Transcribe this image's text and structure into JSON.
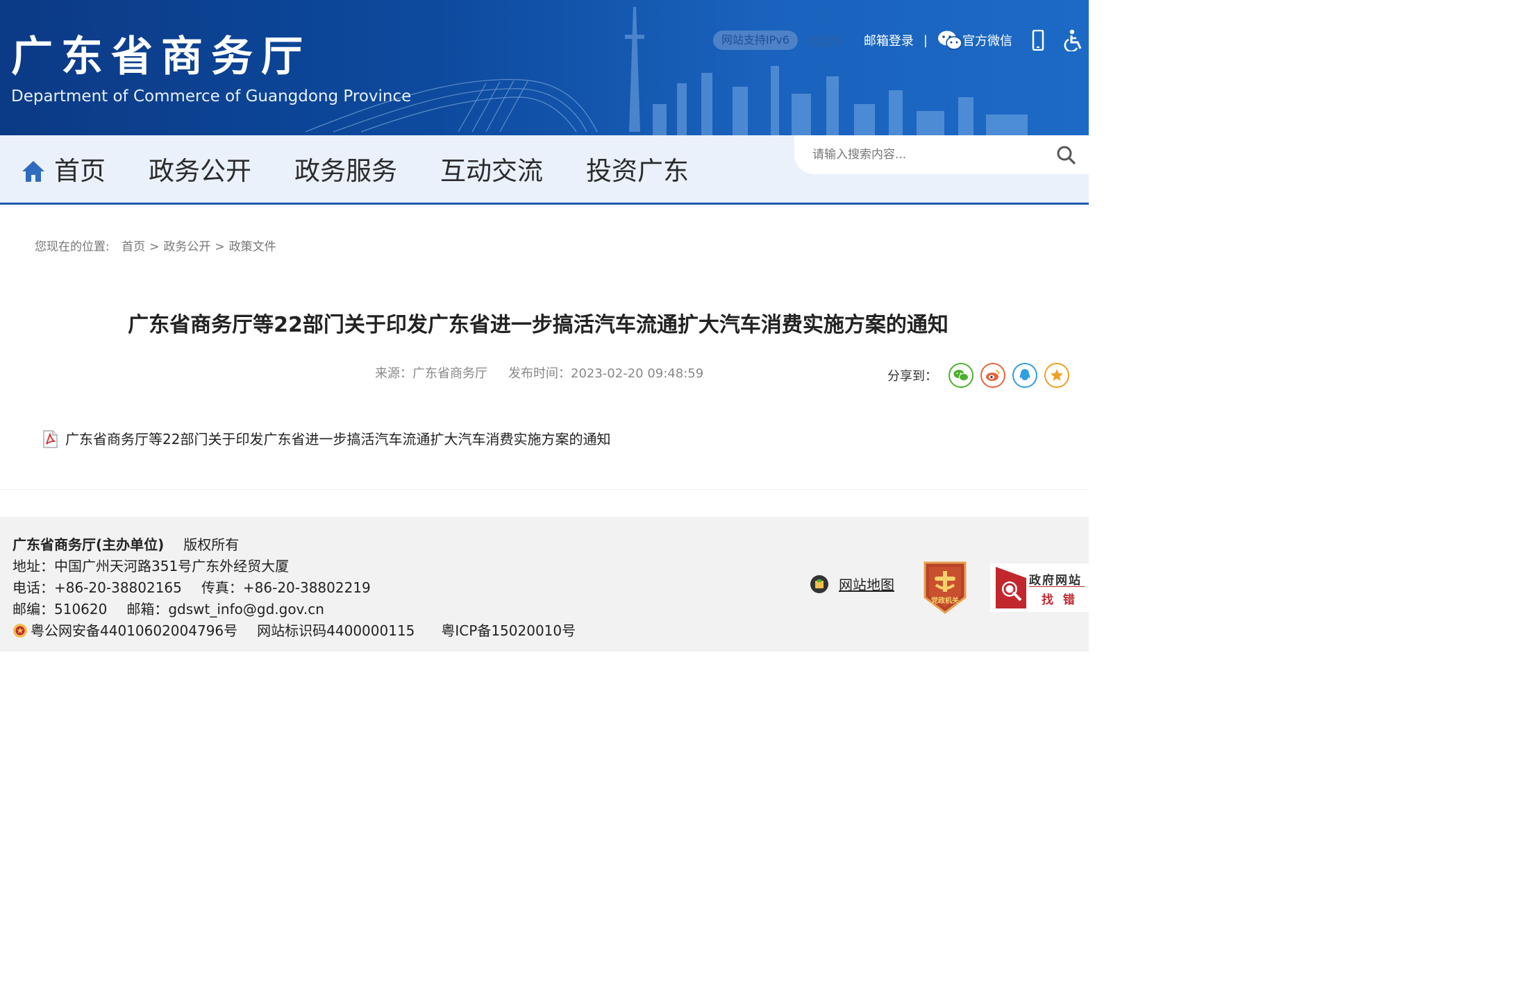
{
  "header": {
    "title": "广东省商务厅",
    "subtitle": "Department of Commerce of Guangdong Province",
    "ipv6_badge": "网站支持IPv6",
    "trial": "试运行",
    "mail_login": "邮箱登录",
    "separator": "|",
    "wechat": "官方微信"
  },
  "nav": {
    "items": [
      "首页",
      "政务公开",
      "政务服务",
      "互动交流",
      "投资广东"
    ]
  },
  "search": {
    "placeholder": "请输入搜索内容..."
  },
  "breadcrumb": {
    "prefix": "您现在的位置:",
    "items": [
      "首页",
      "政务公开",
      "政策文件"
    ],
    "separator": ">"
  },
  "article": {
    "title": "广东省商务厅等22部门关于印发广东省进一步搞活汽车流通扩大汽车消费实施方案的通知",
    "source": "来源：广东省商务厅",
    "published": "发布时间：2023-02-20 09:48:59",
    "share_label": "分享到：",
    "attachment": "广东省商务厅等22部门关于印发广东省进一步搞活汽车流通扩大汽车消费实施方案的通知"
  },
  "footer": {
    "org": "广东省商务厅(主办单位)",
    "copyright": "版权所有",
    "address": "地址：中国广州天河路351号广东外经贸大厦",
    "phone": "电话：+86-20-38802165",
    "fax": "传真：+86-20-38802219",
    "postcode": "邮编：510620",
    "email": "邮箱：gdswt_info@gd.gov.cn",
    "police_record": "粤公网安备44010602004796号",
    "site_code": "网站标识码4400000115",
    "icp": "粤ICP备15020010号",
    "sitemap": "网站地图",
    "party_badge": "党政机关",
    "gov_error_line1": "政府网站",
    "gov_error_line2": "找 错"
  },
  "colors": {
    "banner": "#0d4a9e",
    "nav_bg": "#eaf1fa",
    "nav_border": "#1b5cb3",
    "footer_bg": "#f2f2f2",
    "wechat_green": "#4cb02c",
    "weibo_orange": "#e8643c",
    "qq_blue": "#2e9fe0",
    "star_orange": "#f0a020"
  },
  "icons": {
    "home": "home-icon",
    "search": "search-icon",
    "wechat": "wechat-icon",
    "mobile": "mobile-icon",
    "accessibility": "accessibility-icon",
    "pdf": "pdf-icon"
  }
}
